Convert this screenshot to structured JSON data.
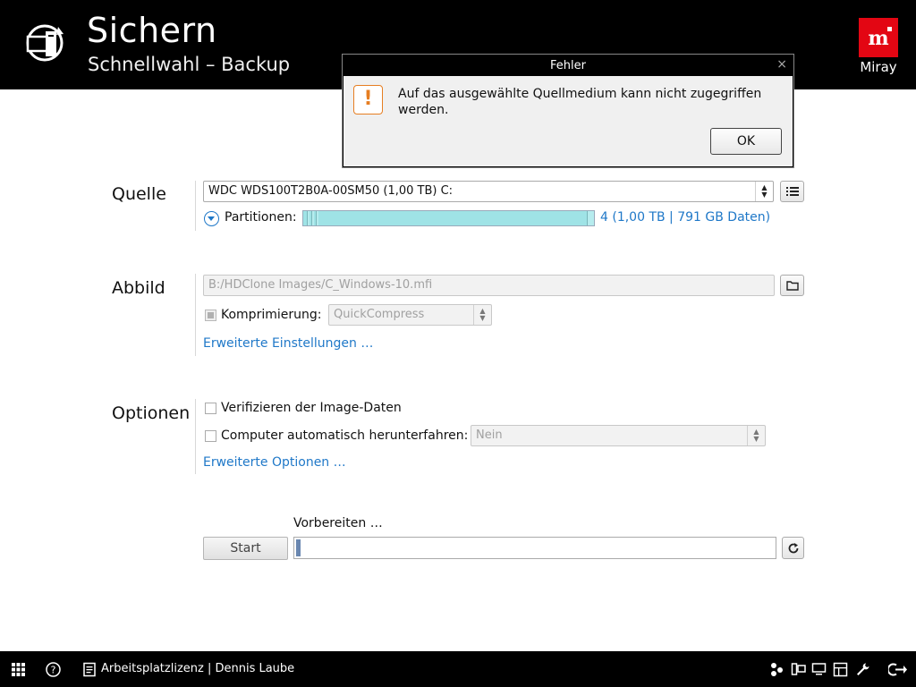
{
  "header": {
    "title": "Sichern",
    "subtitle": "Schnellwahl – Backup",
    "brand_name": "Miray",
    "brand_logo_letter": "m"
  },
  "source": {
    "label": "Quelle",
    "drive": "WDC  WDS100T2B0A-00SM50   (1,00 TB)   C:",
    "partitions_label": "Partitionen:",
    "partitions_info": "4 (1,00 TB | 791 GB Daten)"
  },
  "image": {
    "label": "Abbild",
    "path": "B:/HDClone Images/C_Windows-10.mfi",
    "compression_label": "Komprimierung:",
    "compression_value": "QuickCompress",
    "advanced_link": "Erweiterte Einstellungen …"
  },
  "options": {
    "label": "Optionen",
    "verify_label": "Verifizieren der Image-Daten",
    "shutdown_label": "Computer automatisch herunterfahren:",
    "shutdown_value": "Nein",
    "advanced_link": "Erweiterte Optionen …"
  },
  "start": {
    "status": "Vorbereiten …",
    "button": "Start",
    "progress": 0.01
  },
  "dialog": {
    "title": "Fehler",
    "message": "Auf das ausgewählte Quellmedium kann nicht zugegriffen werden.",
    "ok": "OK",
    "close": "×",
    "warn_symbol": "!"
  },
  "footer": {
    "license": "Arbeitsplatzlizenz  |  Dennis Laube"
  },
  "colors": {
    "accent": "#1f78c8",
    "brand": "#e30613",
    "warning": "#e67e22",
    "partition_bar": "#9fe3e6"
  }
}
